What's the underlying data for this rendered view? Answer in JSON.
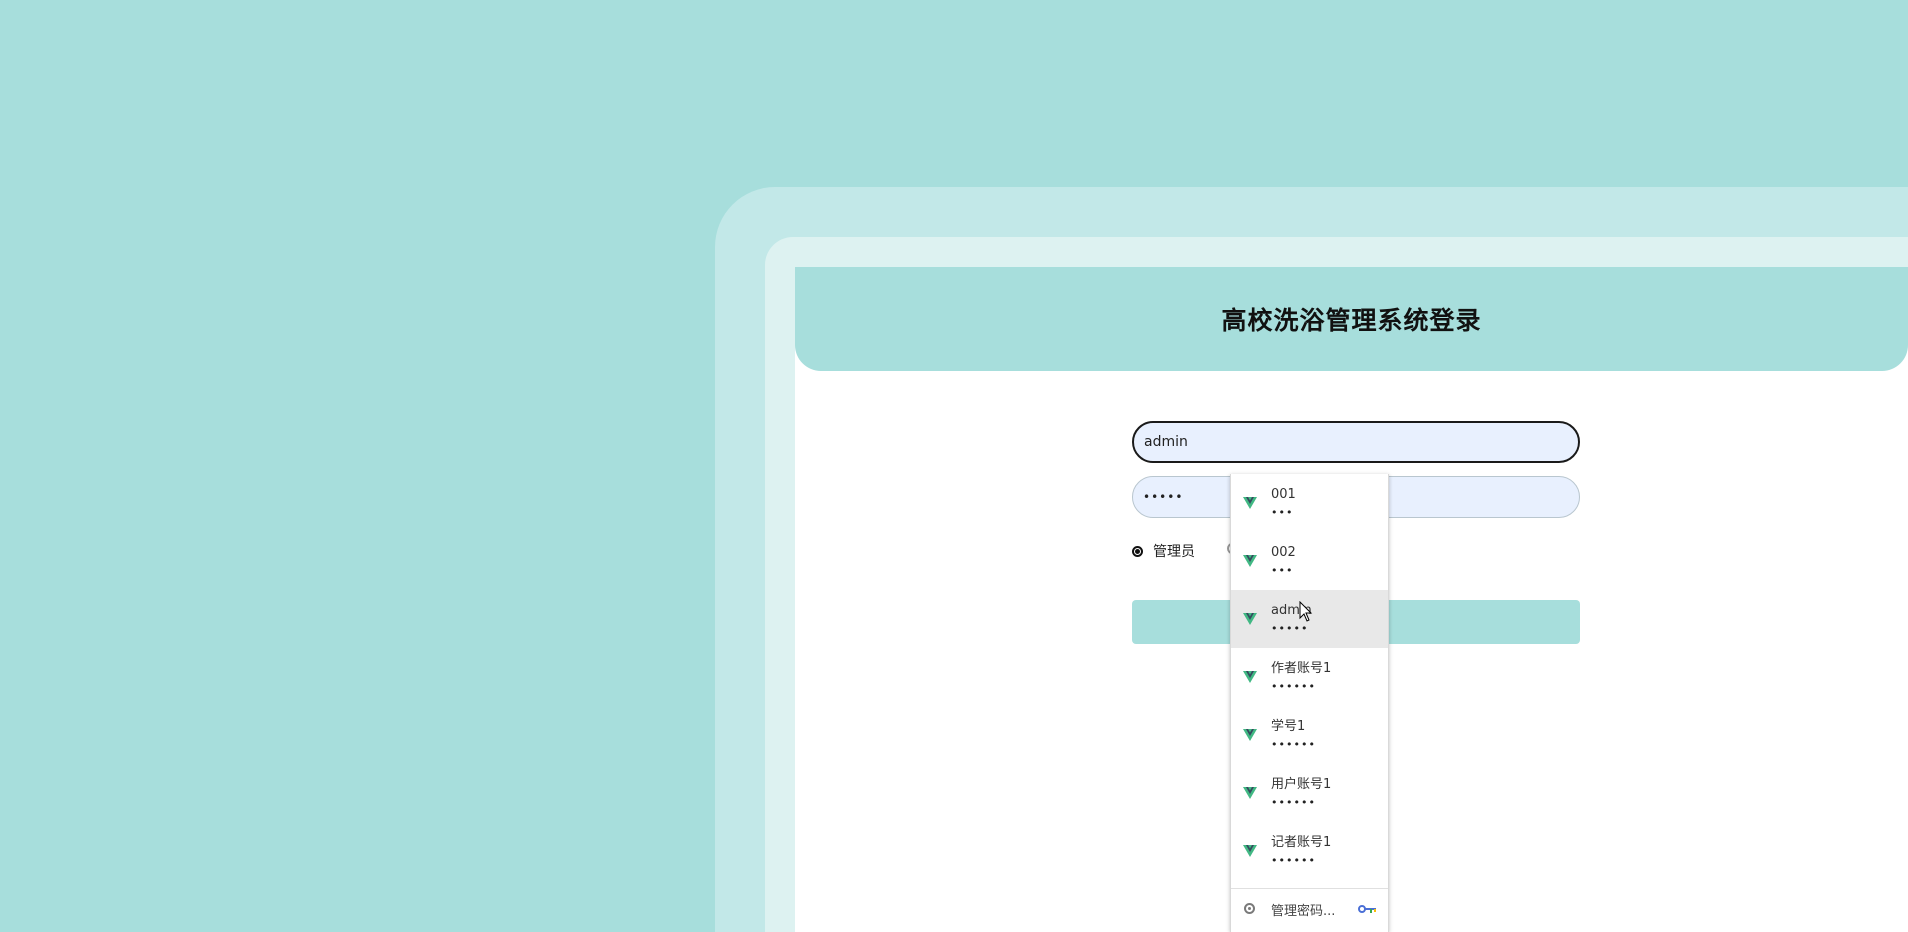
{
  "login": {
    "title": "高校洗浴管理系统登录",
    "username_value": "admin",
    "password_mask": "•••••",
    "role_label": "管理员"
  },
  "autofill": {
    "items": [
      {
        "user": "001",
        "mask": "•••"
      },
      {
        "user": "002",
        "mask": "•••"
      },
      {
        "user": "admin",
        "mask": "•••••"
      },
      {
        "user": "作者账号1",
        "mask": "••••••"
      },
      {
        "user": "学号1",
        "mask": "••••••"
      },
      {
        "user": "用户账号1",
        "mask": "••••••"
      },
      {
        "user": "记者账号1",
        "mask": "••••••"
      }
    ],
    "manage_label": "管理密码..."
  },
  "colors": {
    "background": "#a7dedc",
    "header": "#a7dedc",
    "input_fill": "#e8f0fe",
    "vue_green": "#41b883",
    "vue_dark": "#35495e"
  },
  "icons": {
    "item_logo": "vue-logo-icon",
    "settings": "gear-icon",
    "key": "key-icon"
  }
}
